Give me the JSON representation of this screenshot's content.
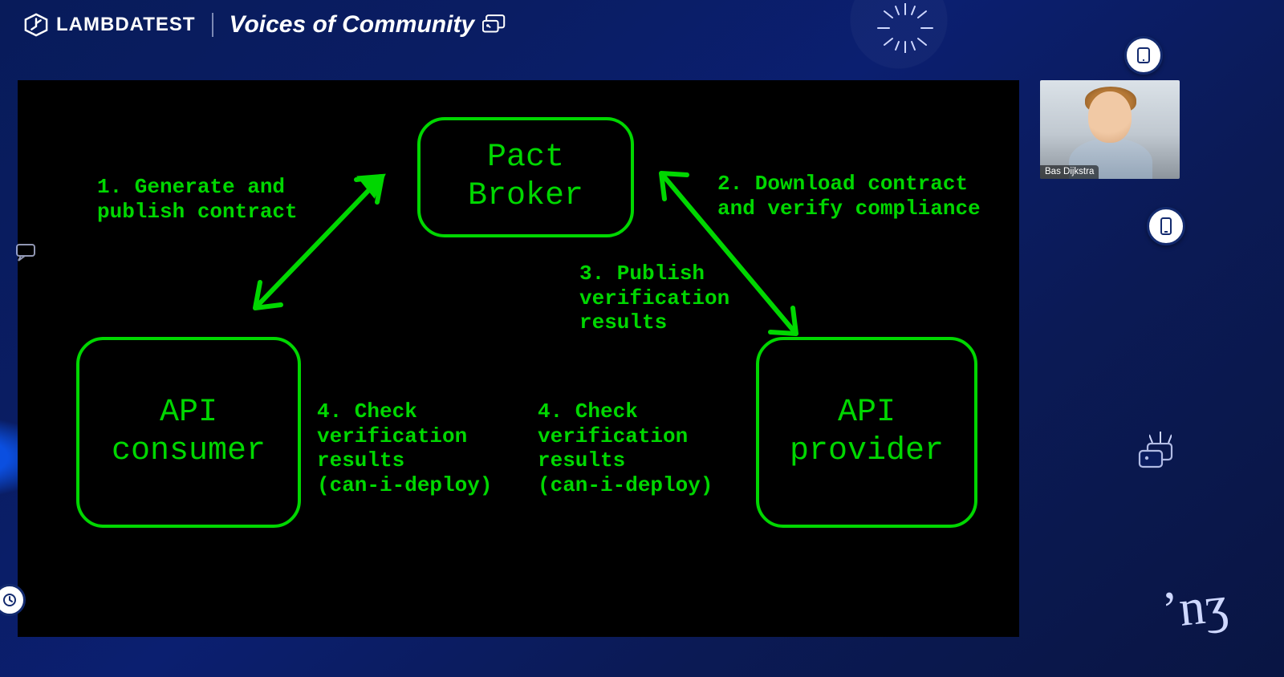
{
  "header": {
    "brand": "LAMBDATEST",
    "series_title": "Voices of Community"
  },
  "speaker": {
    "name": "Bas Dijkstra"
  },
  "diagram": {
    "nodes": {
      "broker": "Pact\nBroker",
      "consumer": "API\nconsumer",
      "provider": "API\nprovider"
    },
    "labels": {
      "step1": "1. Generate and\npublish contract",
      "step2": "2. Download contract\nand verify compliance",
      "step3": "3. Publish\nverification\nresults",
      "step4a": "4. Check\nverification\nresults\n(can-i-deploy)",
      "step4b": "4. Check\nverification\nresults\n(can-i-deploy)"
    },
    "arrows": [
      {
        "from": "consumer",
        "to": "broker",
        "bidirectional": true
      },
      {
        "from": "broker",
        "to": "provider",
        "bidirectional": true
      }
    ],
    "color": "#00d700"
  }
}
